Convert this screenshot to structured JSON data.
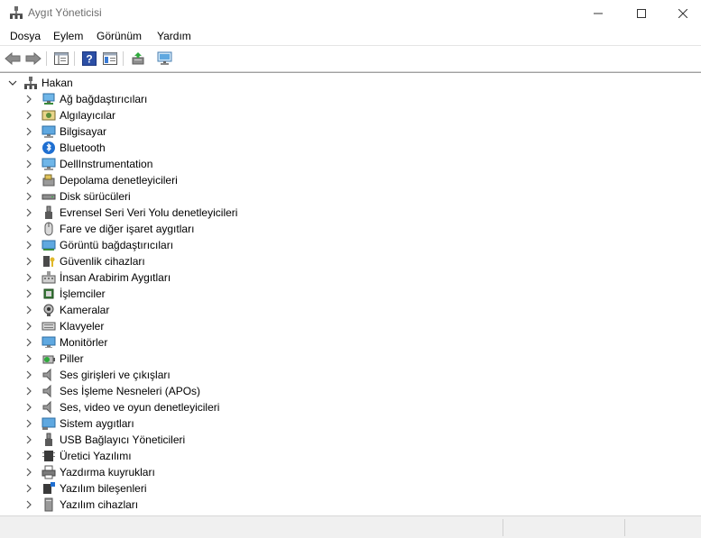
{
  "window": {
    "title": "Aygıt Yöneticisi"
  },
  "menu": [
    "Dosya",
    "Eylem",
    "Görünüm",
    "Yardım"
  ],
  "toolbar": {
    "buttons": [
      "back-arrow-icon",
      "forward-arrow-icon",
      "show-hide-console-tree-icon",
      "help-icon",
      "properties-pane-icon",
      "update-driver-icon",
      "scan-hardware-changes-icon"
    ]
  },
  "tree": {
    "root": "Hakan",
    "categories": [
      {
        "label": "Ağ bağdaştırıcıları",
        "icon": "network-adapter-icon"
      },
      {
        "label": "Algılayıcılar",
        "icon": "sensor-icon"
      },
      {
        "label": "Bilgisayar",
        "icon": "computer-icon"
      },
      {
        "label": "Bluetooth",
        "icon": "bluetooth-icon"
      },
      {
        "label": "DellInstrumentation",
        "icon": "dell-instrumentation-icon"
      },
      {
        "label": "Depolama denetleyicileri",
        "icon": "storage-controller-icon"
      },
      {
        "label": "Disk sürücüleri",
        "icon": "disk-drive-icon"
      },
      {
        "label": "Evrensel Seri Veri Yolu denetleyicileri",
        "icon": "usb-controller-icon"
      },
      {
        "label": "Fare ve diğer işaret aygıtları",
        "icon": "mouse-icon"
      },
      {
        "label": "Görüntü bağdaştırıcıları",
        "icon": "display-adapter-icon"
      },
      {
        "label": "Güvenlik cihazları",
        "icon": "security-device-icon"
      },
      {
        "label": "İnsan Arabirim Aygıtları",
        "icon": "hid-icon"
      },
      {
        "label": "İşlemciler",
        "icon": "processor-icon"
      },
      {
        "label": "Kameralar",
        "icon": "camera-icon"
      },
      {
        "label": "Klavyeler",
        "icon": "keyboard-icon"
      },
      {
        "label": "Monitörler",
        "icon": "monitor-icon"
      },
      {
        "label": "Piller",
        "icon": "battery-icon"
      },
      {
        "label": "Ses girişleri ve çıkışları",
        "icon": "speaker-icon"
      },
      {
        "label": "Ses İşleme Nesneleri (APOs)",
        "icon": "speaker-icon"
      },
      {
        "label": "Ses, video ve oyun denetleyicileri",
        "icon": "speaker-icon"
      },
      {
        "label": "Sistem aygıtları",
        "icon": "system-device-icon"
      },
      {
        "label": "USB Bağlayıcı Yöneticileri",
        "icon": "usb-connector-icon"
      },
      {
        "label": "Üretici Yazılımı",
        "icon": "firmware-icon"
      },
      {
        "label": "Yazdırma kuyrukları",
        "icon": "printer-icon"
      },
      {
        "label": "Yazılım bileşenleri",
        "icon": "software-component-icon"
      },
      {
        "label": "Yazılım cihazları",
        "icon": "software-device-icon"
      }
    ]
  }
}
